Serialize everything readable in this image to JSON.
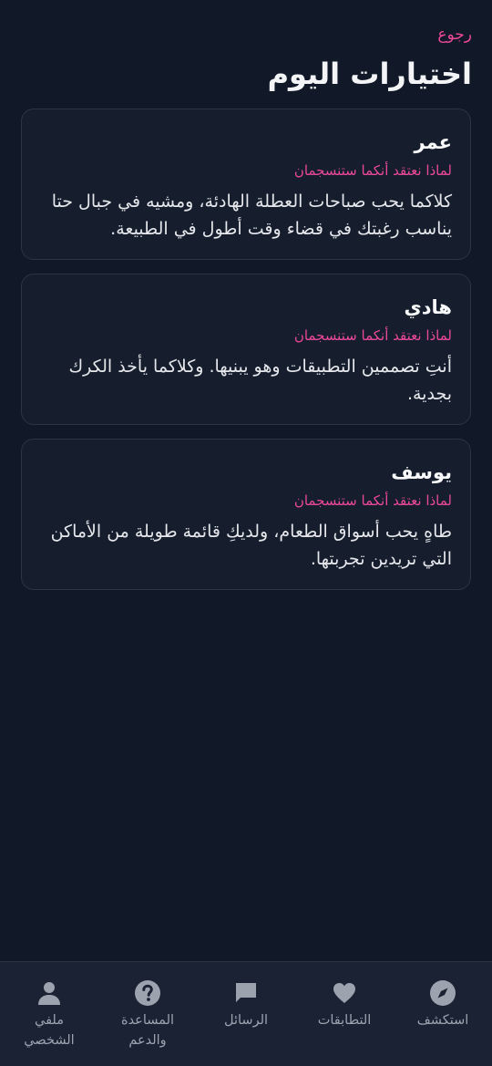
{
  "header": {
    "back_label": "رجوع",
    "title": "اختيارات اليوم"
  },
  "matches": [
    {
      "name": "عمر",
      "why_label": "لماذا نعتقد أنكما ستنسجمان",
      "reason": "كلاكما يحب صباحات العطلة الهادئة، ومشيه في جبال حتا يناسب رغبتك في قضاء وقت أطول في الطبيعة."
    },
    {
      "name": "هادي",
      "why_label": "لماذا نعتقد أنكما ستنسجمان",
      "reason": "أنتِ تصممين التطبيقات وهو يبنيها. وكلاكما يأخذ الكرك بجدية."
    },
    {
      "name": "يوسف",
      "why_label": "لماذا نعتقد أنكما ستنسجمان",
      "reason": "طاهٍ يحب أسواق الطعام، ولديكِ قائمة طويلة من الأماكن التي تريدين تجربتها."
    }
  ],
  "nav": {
    "items": [
      {
        "label": "استكشف",
        "icon": "compass-icon"
      },
      {
        "label": "التطابقات",
        "icon": "heart-icon"
      },
      {
        "label": "الرسائل",
        "icon": "chat-bubble-icon"
      },
      {
        "label": "المساعدة والدعم",
        "icon": "help-circle-icon"
      },
      {
        "label": "ملفي الشخصي",
        "icon": "user-icon"
      }
    ]
  },
  "colors": {
    "background": "#111827",
    "card": "#161e2e",
    "accent": "#ec4899",
    "nav_icon": "#9ca3af"
  }
}
